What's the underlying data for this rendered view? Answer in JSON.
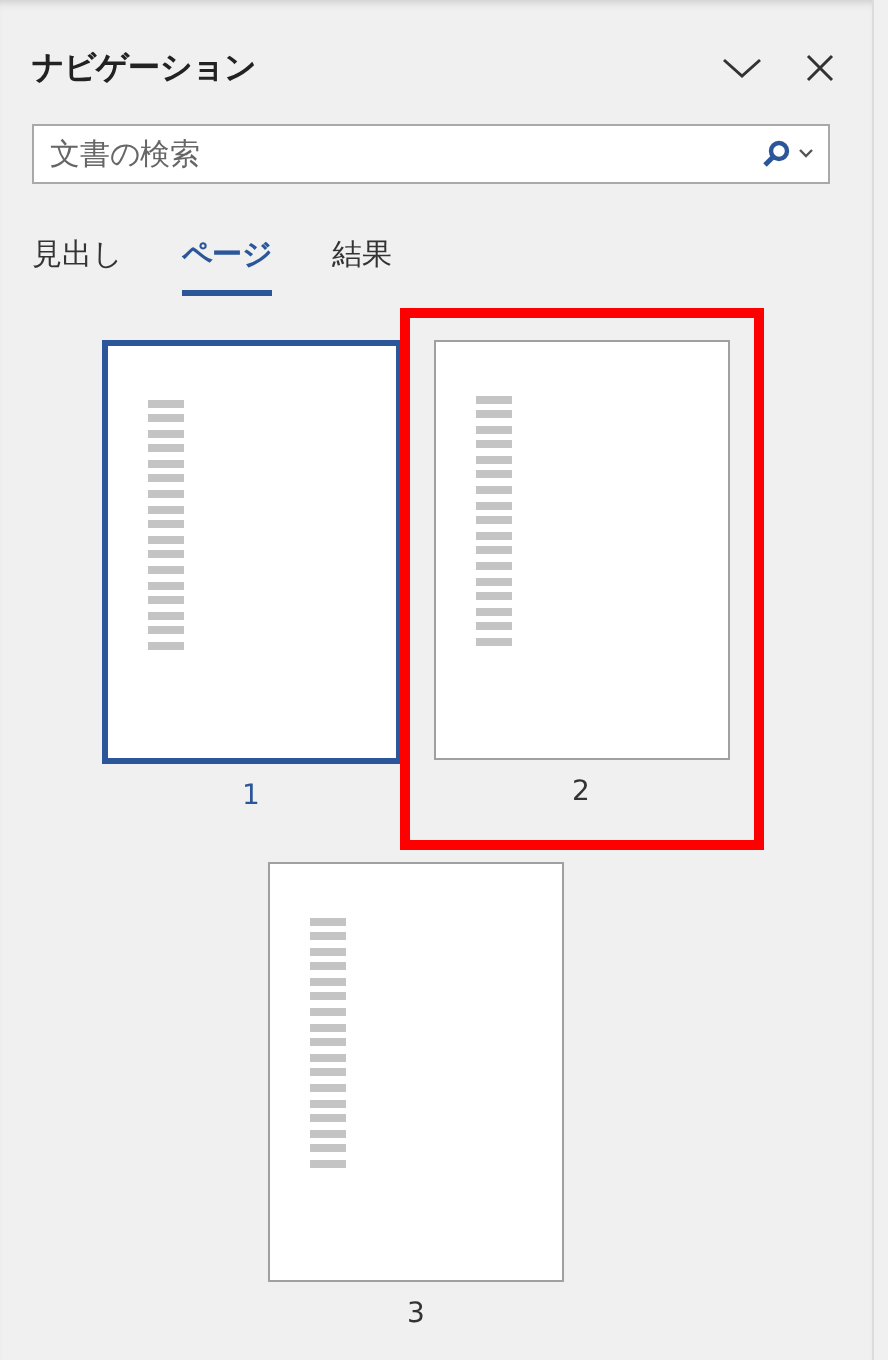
{
  "panel": {
    "title": "ナビゲーション"
  },
  "search": {
    "placeholder": "文書の検索"
  },
  "tabs": [
    {
      "label": "見出し",
      "selected": false
    },
    {
      "label": "ページ",
      "selected": true
    },
    {
      "label": "結果",
      "selected": false
    }
  ],
  "pages": [
    {
      "label": "1",
      "selected": true,
      "highlighted": false
    },
    {
      "label": "2",
      "selected": false,
      "highlighted": true
    },
    {
      "label": "3",
      "selected": false,
      "highlighted": false
    }
  ]
}
